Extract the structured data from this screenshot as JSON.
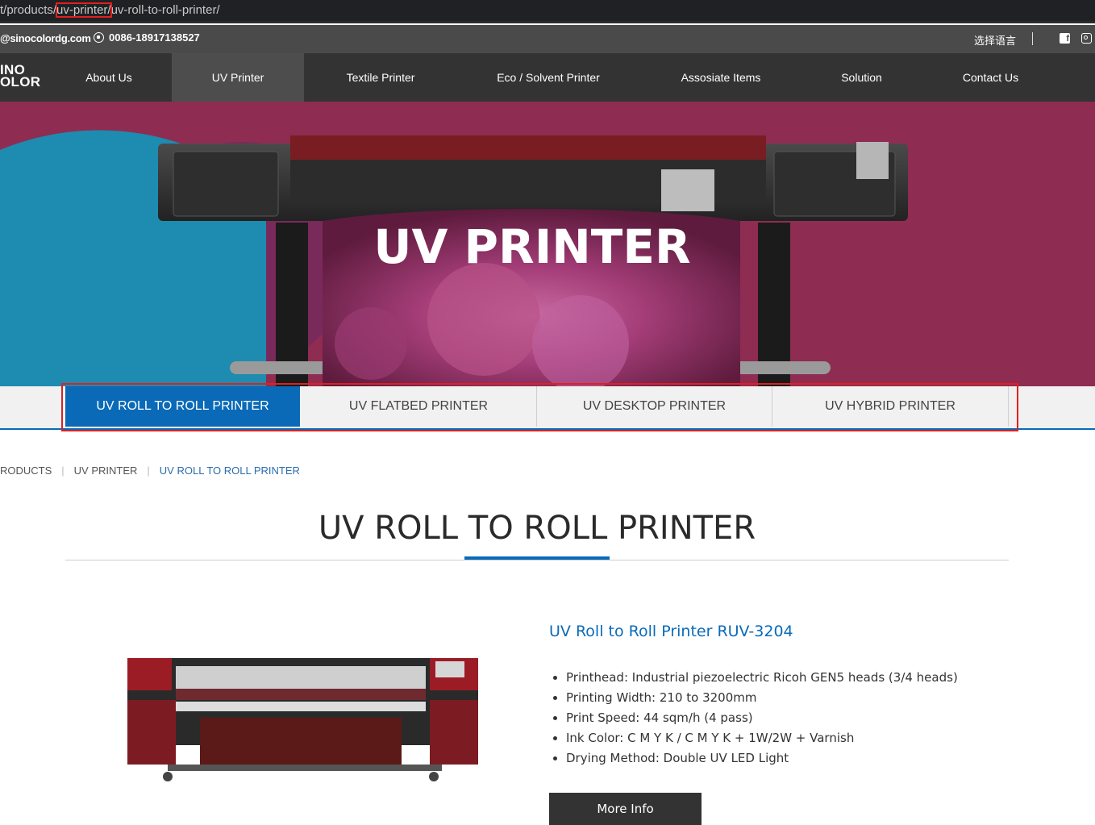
{
  "urlbar": {
    "prefix": "t/products/",
    "highlight": "uv-printer/",
    "suffix": "uv-roll-to-roll-printer/"
  },
  "topbar": {
    "email": "@sinocolordg.com",
    "phone": "0086-18917138527",
    "language": "选择语言"
  },
  "nav": {
    "logo_line1": "INO",
    "logo_line2": "OLOR",
    "items": [
      {
        "label": "About Us"
      },
      {
        "label": "UV Printer"
      },
      {
        "label": "Textile Printer"
      },
      {
        "label": "Eco / Solvent Printer"
      },
      {
        "label": "Assosiate Items"
      },
      {
        "label": "Solution"
      },
      {
        "label": "Contact Us"
      }
    ]
  },
  "banner": {
    "headline": "UV  PRINTER"
  },
  "subtabs": [
    {
      "label": "UV ROLL TO ROLL PRINTER"
    },
    {
      "label": "UV FLATBED PRINTER"
    },
    {
      "label": "UV DESKTOP PRINTER"
    },
    {
      "label": "UV HYBRID PRINTER"
    }
  ],
  "breadcrumb": {
    "items": [
      "RODUCTS",
      "UV PRINTER",
      "UV ROLL TO ROLL PRINTER"
    ]
  },
  "page_title": "UV ROLL TO ROLL PRINTER",
  "product": {
    "title": "UV Roll to Roll Printer RUV-3204",
    "specs": [
      "Printhead: Industrial piezoelectric Ricoh GEN5 heads (3/4 heads)",
      "Printing Width: 210 to 3200mm",
      "Print Speed: 44 sqm/h (4 pass)",
      "Ink Color: C M Y K / C M Y K + 1W/2W + Varnish",
      "Drying Method: Double UV LED Light"
    ],
    "more_label": "More Info"
  },
  "colors": {
    "accent": "#0a6ab8",
    "nav_bg": "#333333",
    "banner_bg": "#8c2b4f",
    "highlight_box": "#e02020"
  }
}
